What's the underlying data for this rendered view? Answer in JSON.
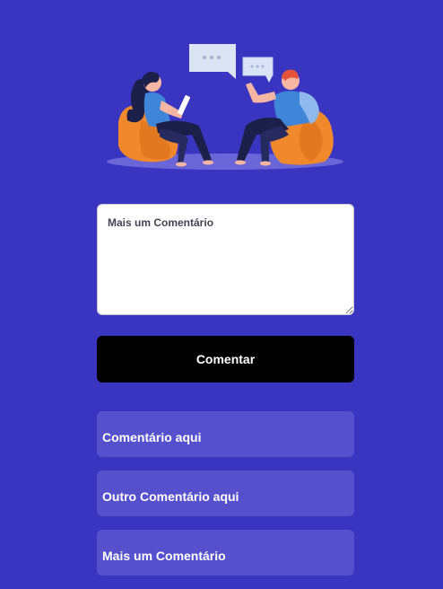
{
  "form": {
    "comment_placeholder": "Mais um Comentário",
    "submit_label": "Comentar"
  },
  "comments": [
    {
      "text": "Comentário aqui"
    },
    {
      "text": "Outro Comentário aqui"
    },
    {
      "text": "Mais um Comentário"
    }
  ],
  "colors": {
    "background": "#3935c0",
    "button": "#000000",
    "comment_card": "#5650cc",
    "text_light": "#ffffff"
  },
  "illustration": {
    "icon": "conversation-illustration"
  }
}
